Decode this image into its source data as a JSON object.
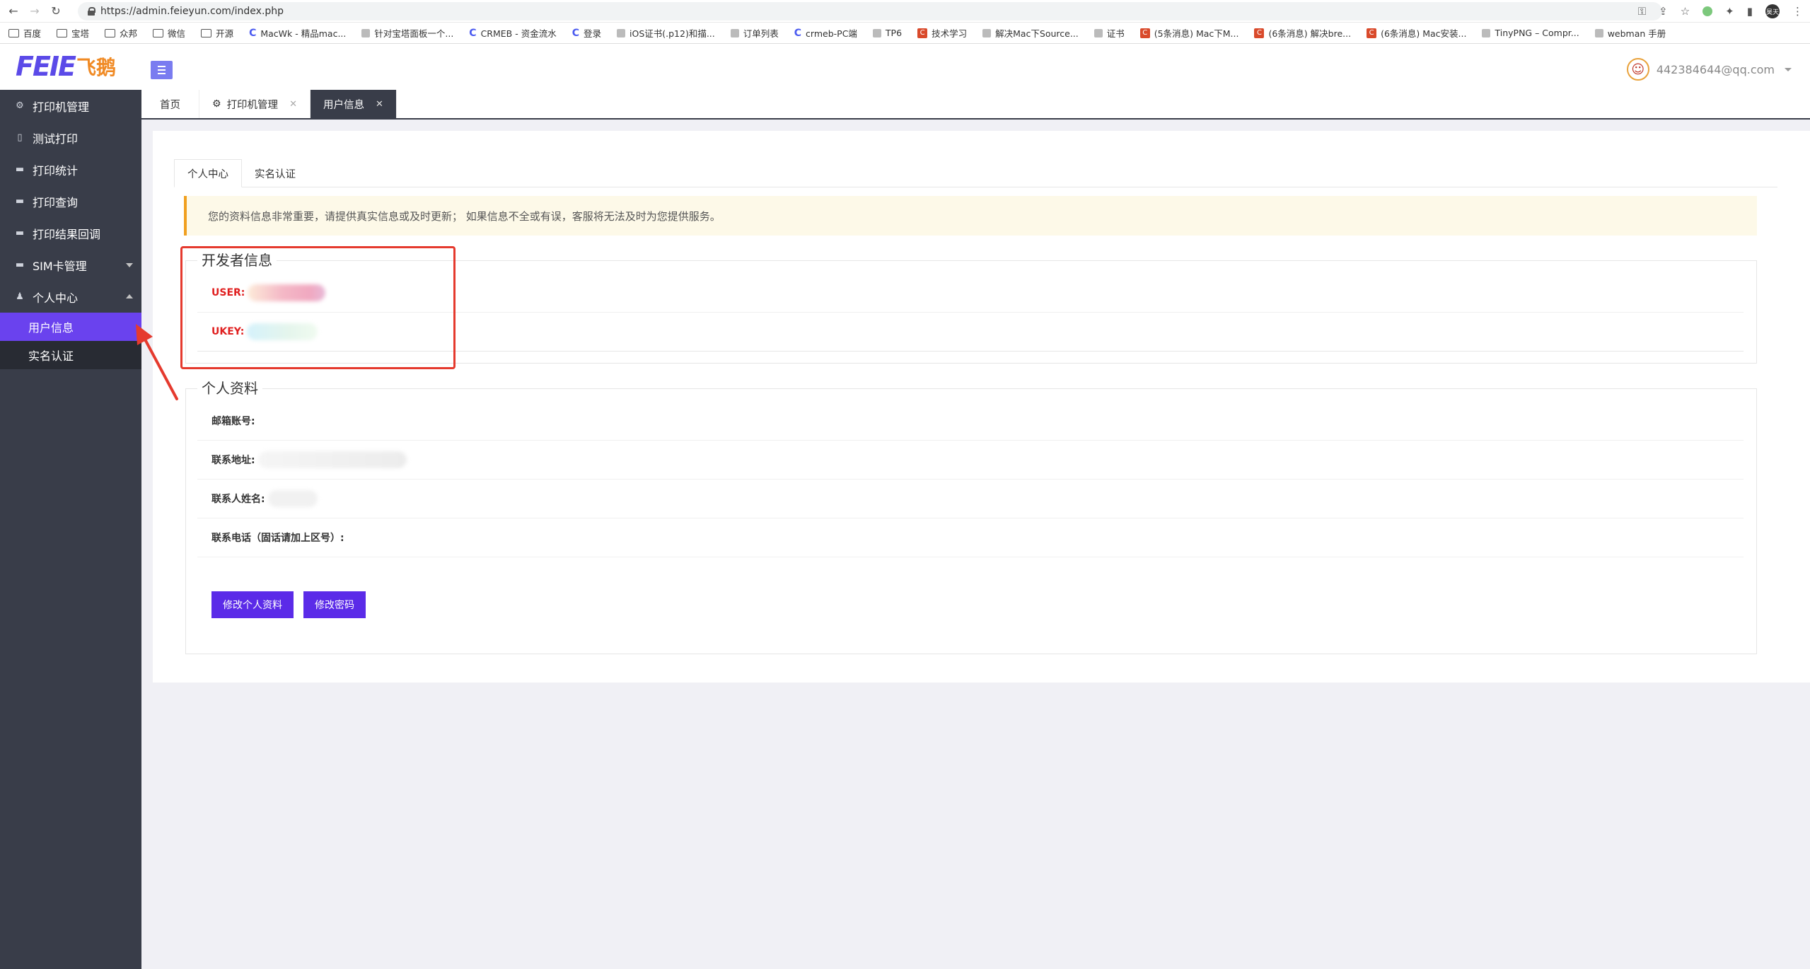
{
  "browser": {
    "url": "https://admin.feieyun.com/index.php",
    "profile_badge": "昊天",
    "bookmarks": [
      {
        "label": "百度",
        "icon": "folder"
      },
      {
        "label": "宝塔",
        "icon": "folder"
      },
      {
        "label": "众邦",
        "icon": "folder"
      },
      {
        "label": "微信",
        "icon": "folder"
      },
      {
        "label": "开源",
        "icon": "folder"
      },
      {
        "label": "MacWk - 精品mac...",
        "icon": "c"
      },
      {
        "label": "针对宝塔面板一个...",
        "icon": "bt"
      },
      {
        "label": "CRMEB - 资金流水",
        "icon": "c"
      },
      {
        "label": "登录",
        "icon": "c"
      },
      {
        "label": "iOS证书(.p12)和描...",
        "icon": "d"
      },
      {
        "label": "订单列表",
        "icon": "globe"
      },
      {
        "label": "crmeb-PC端",
        "icon": "c"
      },
      {
        "label": "TP6",
        "icon": "tp"
      },
      {
        "label": "技术学习",
        "icon": "red-c"
      },
      {
        "label": "解决Mac下Source...",
        "icon": "red-box"
      },
      {
        "label": "证书",
        "icon": "img"
      },
      {
        "label": "(5条消息) Mac下M...",
        "icon": "red-c"
      },
      {
        "label": "(6条消息) 解决bre...",
        "icon": "red-c"
      },
      {
        "label": "(6条消息) Mac安装...",
        "icon": "red-c"
      },
      {
        "label": "TinyPNG – Compr...",
        "icon": "panda"
      },
      {
        "label": "webman 手册",
        "icon": "w"
      }
    ]
  },
  "header": {
    "logo_text": "FEIE",
    "logo_cn": "飞鹅",
    "user_email": "442384644@qq.com"
  },
  "sidebar": {
    "items": [
      {
        "label": "打印机管理",
        "icon": "printer-icon"
      },
      {
        "label": "测试打印",
        "icon": "document-icon"
      },
      {
        "label": "打印统计",
        "icon": "chat-icon"
      },
      {
        "label": "打印查询",
        "icon": "chat-icon"
      },
      {
        "label": "打印结果回调",
        "icon": "chat-icon"
      },
      {
        "label": "SIM卡管理",
        "icon": "chat-icon"
      },
      {
        "label": "个人中心",
        "icon": "user-icon"
      }
    ],
    "sub_items": [
      {
        "label": "用户信息",
        "active": true
      },
      {
        "label": "实名认证",
        "active": false
      }
    ]
  },
  "tabs": [
    {
      "label": "首页"
    },
    {
      "label": "打印机管理"
    },
    {
      "label": "用户信息"
    }
  ],
  "content": {
    "inner_tabs": [
      "个人中心",
      "实名认证"
    ],
    "notice": "您的资料信息非常重要，请提供真实信息或及时更新； 如果信息不全或有误，客服将无法及时为您提供服务。",
    "developer": {
      "legend": "开发者信息",
      "user_label": "USER:",
      "ukey_label": "UKEY:"
    },
    "profile": {
      "legend": "个人资料",
      "email_label": "邮箱账号:",
      "address_label": "联系地址:",
      "contact_label": "联系人姓名:",
      "phone_label": "联系电话（固话请加上区号）:"
    },
    "buttons": {
      "edit_profile": "修改个人资料",
      "change_password": "修改密码"
    }
  },
  "colors": {
    "sidebar_bg": "#393d49",
    "active_purple": "#6a42ee",
    "button_purple": "#5b2be8",
    "highlight_red": "#e53a2e"
  }
}
